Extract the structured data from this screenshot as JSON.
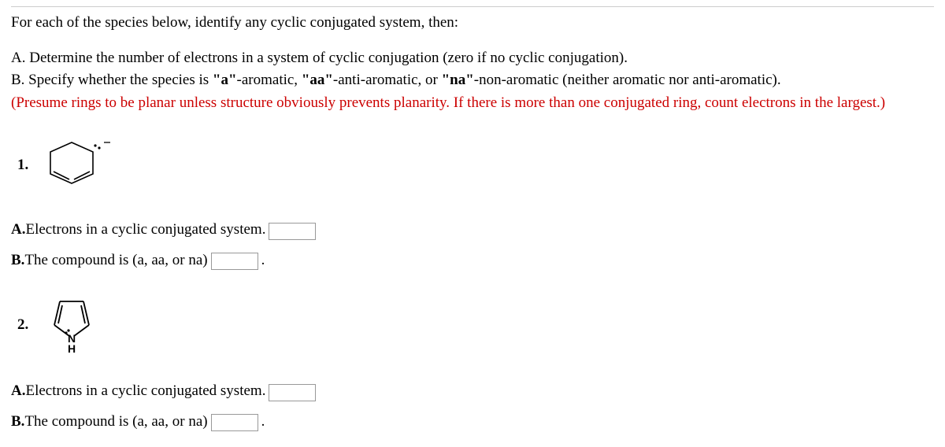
{
  "intro": {
    "line1": "For each of the species below, identify any cyclic conjugated system, then:",
    "partA": "A. Determine the number of electrons in a system of cyclic conjugation (zero if no cyclic conjugation).",
    "partB_prefix": "B. Specify whether the species is ",
    "partB_a_bold": "\"a\"",
    "partB_a_text": "-aromatic, ",
    "partB_aa_bold": "\"aa\"",
    "partB_aa_text": "-anti-aromatic, or ",
    "partB_na_bold": "\"na\"",
    "partB_na_text": "-non-aromatic (neither aromatic nor anti-aromatic).",
    "hint": "(Presume rings to be planar unless structure obviously prevents planarity. If there is more than one conjugated ring, count electrons in the largest.)"
  },
  "questions": [
    {
      "number": "1.",
      "structure_desc": "Cyclohexadienyl anion with lone pair and negative charge",
      "answerA_bold": "A.",
      "answerA_text": "Electrons in a cyclic conjugated system.",
      "answerB_bold": "B.",
      "answerB_text": "The compound is (a, aa, or na)"
    },
    {
      "number": "2.",
      "structure_desc": "Pyrrole (five-membered ring with NH)",
      "answerA_bold": "A.",
      "answerA_text": "Electrons in a cyclic conjugated system.",
      "answerB_bold": "B.",
      "answerB_text": "The compound is (a, aa, or na)"
    }
  ]
}
